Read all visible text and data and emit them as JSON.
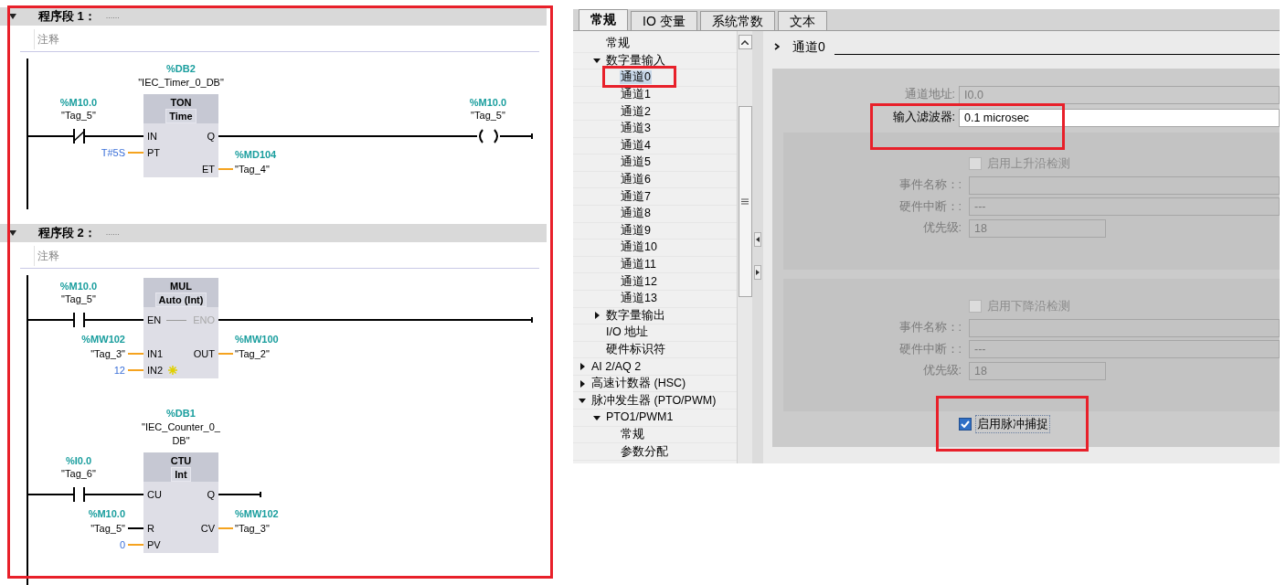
{
  "program": {
    "networks": [
      {
        "title": "程序段 1：",
        "title_note": "......",
        "comment": "注释",
        "rungs": [
          {
            "instance": {
              "address": "%DB2",
              "tag": "\"IEC_Timer_0_DB\""
            },
            "contact": {
              "kind": "nc",
              "address": "%M10.0",
              "tag": "\"Tag_5\""
            },
            "block": {
              "name": "TON",
              "type": "Time"
            },
            "rows": [
              {
                "in": {
                  "pin": "IN",
                  "greyed": false
                },
                "out": {
                  "pin": "Q",
                  "greyed": false
                }
              },
              {
                "in": {
                  "pin": "PT",
                  "greyed": false,
                  "operand": {
                    "kind": "constant",
                    "value": "T#5S"
                  }
                }
              },
              {
                "out": {
                  "pin": "ET",
                  "greyed": false,
                  "operand": {
                    "kind": "word",
                    "address": "%MD104",
                    "tag": "\"Tag_4\""
                  }
                }
              }
            ],
            "end": {
              "kind": "coil",
              "address": "%M10.0",
              "tag": "\"Tag_5\""
            }
          }
        ]
      },
      {
        "title": "程序段 2：",
        "title_note": "......",
        "comment": "注释",
        "rungs": [
          {
            "contact": {
              "kind": "no",
              "address": "%M10.0",
              "tag": "\"Tag_5\""
            },
            "block": {
              "name": "MUL",
              "type": "Auto (Int)"
            },
            "rows": [
              {
                "in": {
                  "pin": "EN",
                  "greyed": false
                },
                "out": {
                  "pin": "ENO",
                  "greyed": true
                }
              },
              {
                "in": {
                  "pin": "IN1",
                  "greyed": false,
                  "operand": {
                    "kind": "word",
                    "address": "%MW102",
                    "tag": "\"Tag_3\""
                  }
                },
                "out": {
                  "pin": "OUT",
                  "greyed": false,
                  "operand": {
                    "kind": "word",
                    "address": "%MW100",
                    "tag": "\"Tag_2\""
                  }
                }
              },
              {
                "in": {
                  "pin": "IN2",
                  "greyed": false,
                  "add_input_marker": true,
                  "operand": {
                    "kind": "constant",
                    "value": "12"
                  }
                }
              }
            ],
            "end": {
              "kind": "wire"
            }
          },
          {
            "instance": {
              "address": "%DB1",
              "tag": "\"IEC_Counter_0_DB\""
            },
            "contact": {
              "kind": "no",
              "address": "%I0.0",
              "tag": "\"Tag_6\""
            },
            "block": {
              "name": "CTU",
              "type": "Int"
            },
            "rows": [
              {
                "in": {
                  "pin": "CU",
                  "greyed": false
                },
                "out": {
                  "pin": "Q",
                  "greyed": false
                }
              },
              {
                "in": {
                  "pin": "R",
                  "greyed": false,
                  "operand": {
                    "kind": "bool",
                    "address": "%M10.0",
                    "tag": "\"Tag_5\""
                  }
                },
                "out": {
                  "pin": "CV",
                  "greyed": false,
                  "operand": {
                    "kind": "word",
                    "address": "%MW102",
                    "tag": "\"Tag_3\""
                  }
                }
              },
              {
                "in": {
                  "pin": "PV",
                  "greyed": false,
                  "operand": {
                    "kind": "constant",
                    "value": "0"
                  }
                }
              }
            ],
            "end": {
              "kind": "stub"
            }
          }
        ]
      }
    ]
  },
  "tabs": [
    {
      "label": "常规",
      "selected": true
    },
    {
      "label": "IO 变量",
      "selected": false
    },
    {
      "label": "系统常数",
      "selected": false
    },
    {
      "label": "文本",
      "selected": false
    }
  ],
  "tree": {
    "continued": [
      {
        "label": "常规",
        "kind": "leaf",
        "selected": false
      },
      {
        "label": "数字量输入",
        "kind": "group",
        "expanded": true,
        "selected": false,
        "children": [
          {
            "label": "通道0",
            "kind": "leaf",
            "selected": true
          },
          {
            "label": "通道1",
            "kind": "leaf",
            "selected": false
          },
          {
            "label": "通道2",
            "kind": "leaf",
            "selected": false
          },
          {
            "label": "通道3",
            "kind": "leaf",
            "selected": false
          },
          {
            "label": "通道4",
            "kind": "leaf",
            "selected": false
          },
          {
            "label": "通道5",
            "kind": "leaf",
            "selected": false
          },
          {
            "label": "通道6",
            "kind": "leaf",
            "selected": false
          },
          {
            "label": "通道7",
            "kind": "leaf",
            "selected": false
          },
          {
            "label": "通道8",
            "kind": "leaf",
            "selected": false
          },
          {
            "label": "通道9",
            "kind": "leaf",
            "selected": false
          },
          {
            "label": "通道10",
            "kind": "leaf",
            "selected": false
          },
          {
            "label": "通道11",
            "kind": "leaf",
            "selected": false
          },
          {
            "label": "通道12",
            "kind": "leaf",
            "selected": false
          },
          {
            "label": "通道13",
            "kind": "leaf",
            "selected": false
          }
        ]
      },
      {
        "label": "数字量输出",
        "kind": "group",
        "expanded": false,
        "selected": false
      },
      {
        "label": "I/O 地址",
        "kind": "leaf",
        "selected": false
      },
      {
        "label": "硬件标识符",
        "kind": "leaf",
        "selected": false
      }
    ],
    "items": [
      {
        "label": "AI 2/AQ 2",
        "kind": "group",
        "expanded": false,
        "selected": false
      },
      {
        "label": "高速计数器 (HSC)",
        "kind": "group",
        "expanded": false,
        "selected": false
      },
      {
        "label": "脉冲发生器 (PTO/PWM)",
        "kind": "group",
        "expanded": true,
        "selected": false,
        "children": [
          {
            "label": "PTO1/PWM1",
            "kind": "group",
            "expanded": true,
            "selected": false,
            "children": [
              {
                "label": "常规",
                "kind": "leaf",
                "selected": false
              },
              {
                "label": "参数分配",
                "kind": "leaf",
                "selected": false
              }
            ]
          }
        ]
      }
    ]
  },
  "properties": {
    "section_title": "通道0",
    "fields": [
      {
        "label": "通道地址:",
        "value": "I0.0",
        "disabled": true
      },
      {
        "label": "输入滤波器:",
        "value": "0.1 microsec",
        "disabled": false
      }
    ],
    "groups": [
      {
        "checkbox": {
          "label": "启用上升沿检测",
          "checked": false,
          "disabled": true,
          "focused": false
        },
        "fields": [
          {
            "label": "事件名称：:",
            "kind": "wide",
            "disabled": true
          },
          {
            "label": "硬件中断：:",
            "value": "---",
            "kind": "wide",
            "disabled": true
          },
          {
            "label": "优先级:",
            "value": "18",
            "kind": "short",
            "disabled": true
          }
        ]
      },
      {
        "checkbox": {
          "label": "启用下降沿检测",
          "checked": false,
          "disabled": true,
          "focused": false
        },
        "fields": [
          {
            "label": "事件名称：:",
            "kind": "wide",
            "disabled": true
          },
          {
            "label": "硬件中断：:",
            "value": "---",
            "kind": "wide",
            "disabled": true
          },
          {
            "label": "优先级:",
            "value": "18",
            "kind": "short",
            "disabled": true
          }
        ]
      }
    ],
    "pulse_catch": {
      "label": "启用脉冲捕捉",
      "checked": true,
      "disabled": false,
      "focused": true
    }
  },
  "highlight_frames": [
    {
      "kind": "ladder"
    },
    {
      "kind": "tree-selection"
    },
    {
      "kind": "input-filter"
    },
    {
      "kind": "pulse-catch"
    }
  ]
}
